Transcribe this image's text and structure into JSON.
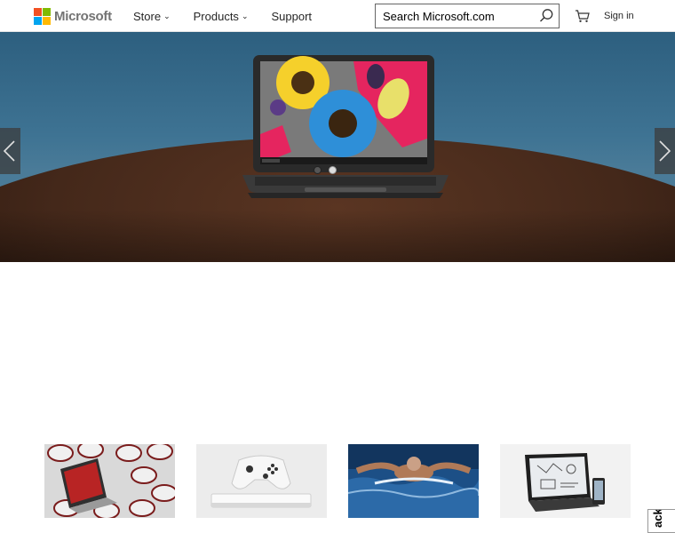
{
  "header": {
    "logo_text": "Microsoft",
    "logo_colors": [
      "#f25022",
      "#7fba00",
      "#00a4ef",
      "#ffb900"
    ],
    "nav": [
      {
        "label": "Store",
        "has_dropdown": true
      },
      {
        "label": "Products",
        "has_dropdown": true
      },
      {
        "label": "Support",
        "has_dropdown": false
      }
    ],
    "chevron": "⌄",
    "search": {
      "placeholder": "Search Microsoft.com",
      "icon": "search-icon"
    },
    "cart_icon": "cart-icon",
    "sign_in": "Sign in"
  },
  "hero": {
    "image": "laptop-on-table",
    "prev_icon": "chevron-left-icon",
    "next_icon": "chevron-right-icon",
    "slides_total": 2,
    "active_slide": 2
  },
  "tiles": [
    {
      "image": "surface-laptop-football-helmets"
    },
    {
      "image": "xbox-one-s-console-controller"
    },
    {
      "image": "swimmer-butterfly-stroke"
    },
    {
      "image": "convertible-tablet-and-phone"
    }
  ],
  "feedback": {
    "label": "ack"
  }
}
